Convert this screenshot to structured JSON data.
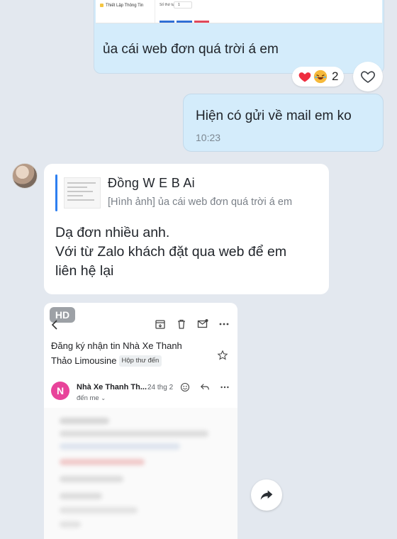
{
  "top_bubble": {
    "screenshot": {
      "side_label": "Thiết Lập Thông Tin",
      "field_label": "Số thứ tự",
      "field_value": "1"
    },
    "text": "ủa cái web đơn quá trời á em",
    "reactions": {
      "icons": [
        "heart-emoji",
        "laughing-emoji"
      ],
      "count": "2"
    }
  },
  "outgoing_message": {
    "text": "Hiện có gửi về mail em ko",
    "time": "10:23"
  },
  "reply_message": {
    "quote": {
      "sender": "Đồng W E B Ai",
      "snippet": "[Hình ảnh] ủa cái web đơn quá trời á em"
    },
    "lines": [
      "Dạ đơn nhiều anh.",
      "Với từ Zalo khách đặt qua web để em",
      "liên hệ lại"
    ]
  },
  "email_image": {
    "badge": "HD",
    "subject_line1": "Đăng ký nhận tin Nhà Xe Thanh",
    "subject_line2": "Thảo Limousine",
    "folder_tag": "Hộp thư đến",
    "sender_initial": "N",
    "sender_name": "Nhà Xe Thanh Th...",
    "date": "24 thg 2",
    "recipient": "đến me",
    "avatar_color": "#e8439a"
  },
  "colors": {
    "background": "#e3e8ef",
    "outgoing_bubble": "#d4ecfb",
    "incoming_bubble": "#ffffff",
    "quote_accent": "#2d7ff0"
  }
}
